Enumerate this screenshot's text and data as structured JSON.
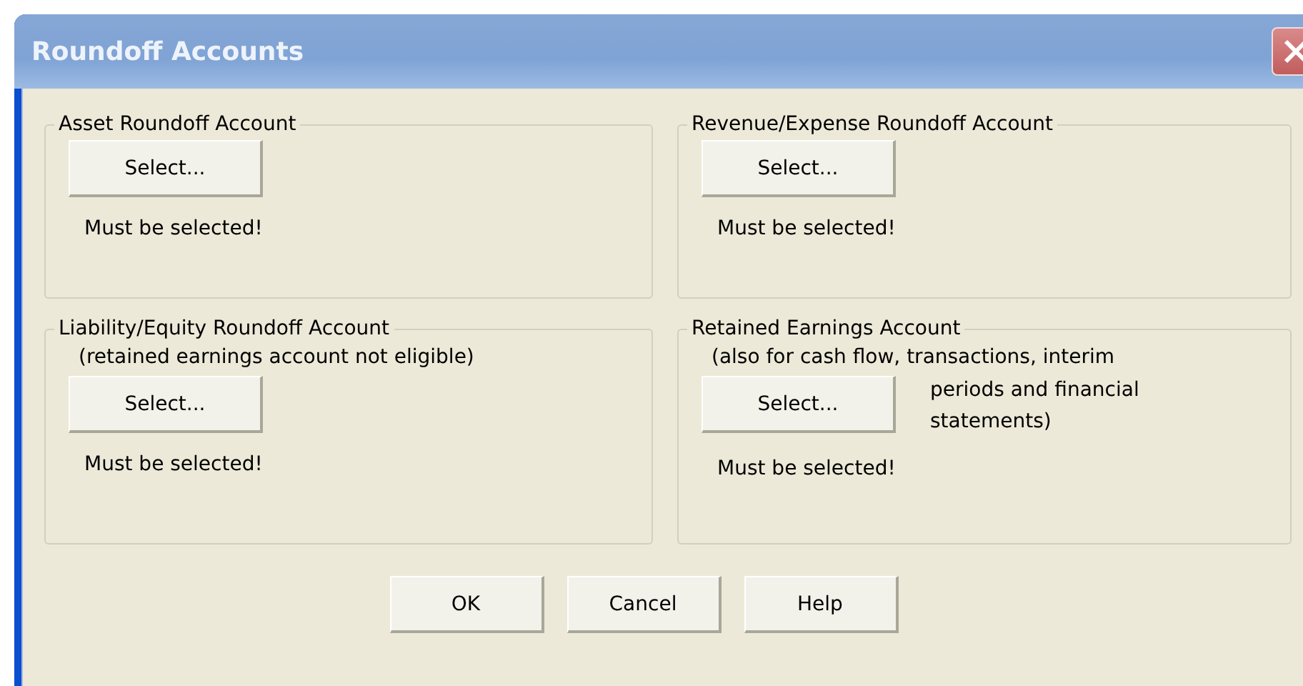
{
  "window": {
    "title": "Roundoff Accounts"
  },
  "groups": [
    {
      "title": "Asset Roundoff Account",
      "button": "Select...",
      "status": "Must be selected!"
    },
    {
      "title": "Revenue/Expense Roundoff Account",
      "button": "Select...",
      "status": "Must be selected!"
    },
    {
      "title": "Liability/Equity Roundoff Account",
      "note": "(retained earnings account not eligible)",
      "button": "Select...",
      "status": "Must be selected!"
    },
    {
      "title": "Retained Earnings Account",
      "note": "(also for cash flow, transactions, interim",
      "side_note": "periods and financial statements)",
      "button": "Select...",
      "status": "Must be selected!"
    }
  ],
  "buttons": [
    "OK",
    "Cancel",
    "Help"
  ]
}
